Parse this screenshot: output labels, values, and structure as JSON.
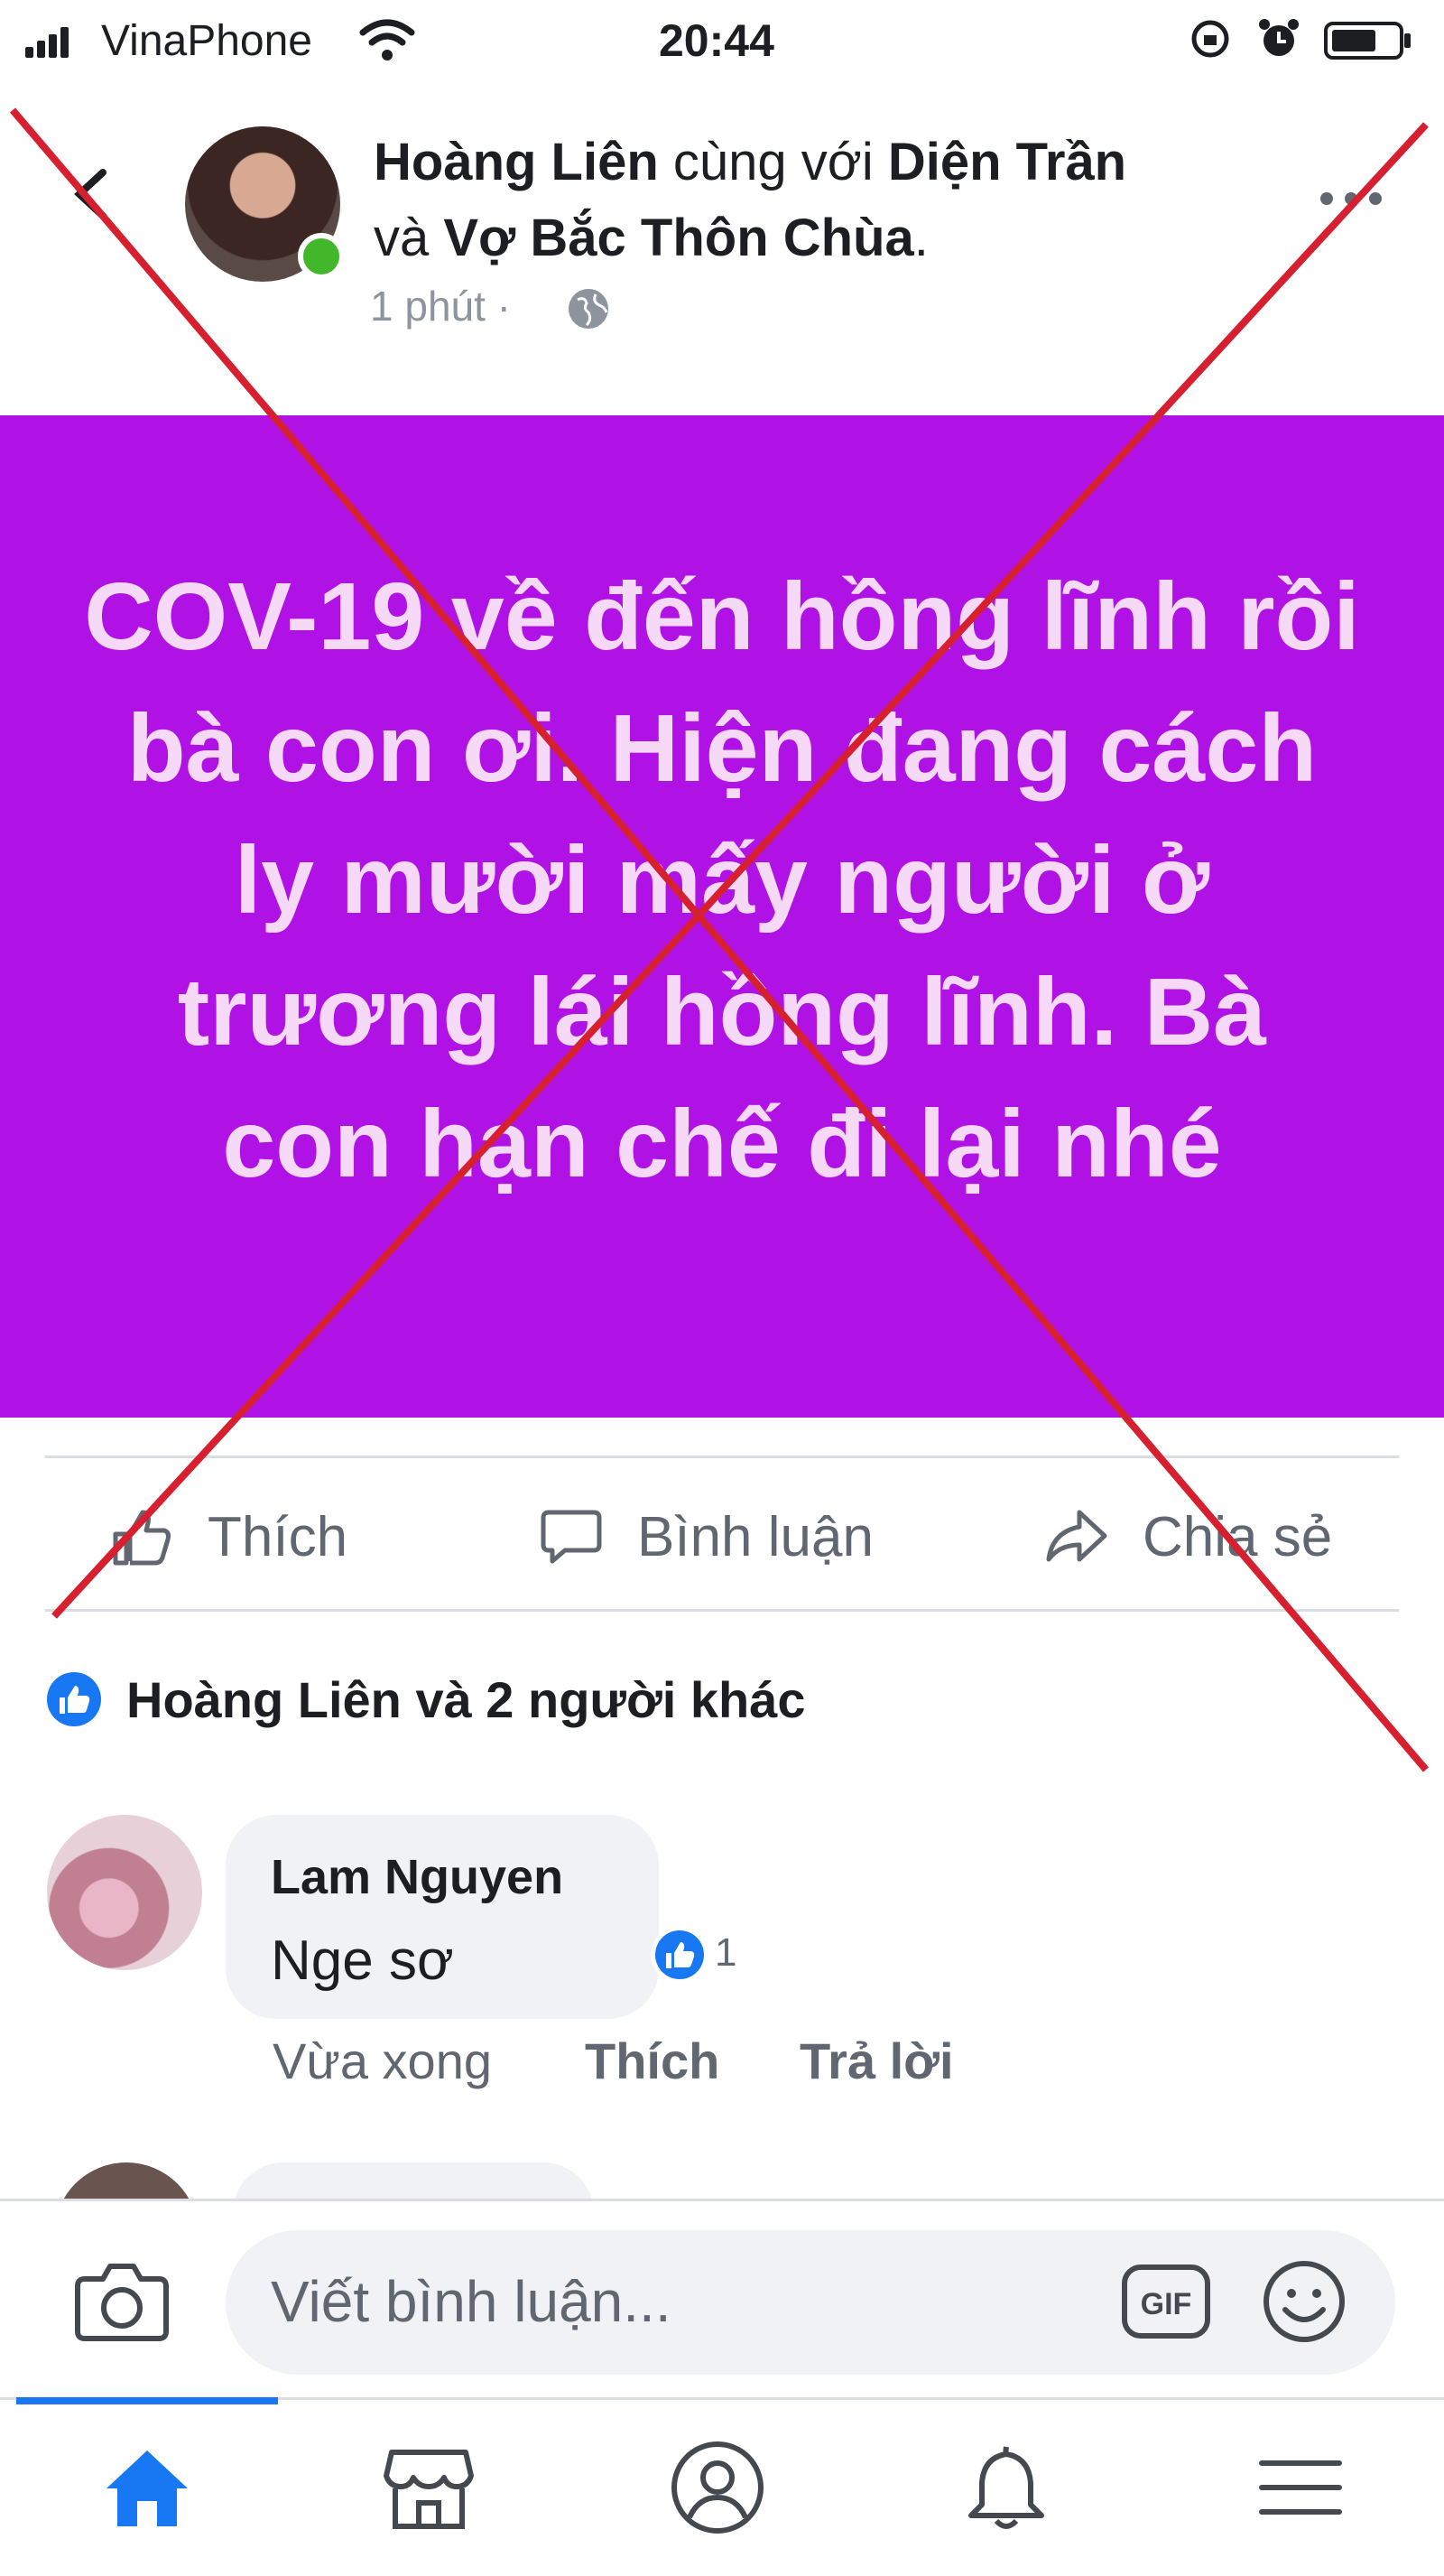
{
  "status_bar": {
    "carrier": "VinaPhone",
    "time": "20:44",
    "icons": [
      "signal-icon",
      "wifi-icon",
      "rotation-lock-icon",
      "alarm-icon",
      "battery-icon"
    ]
  },
  "post": {
    "author": "Hoàng Liên",
    "with_word": " cùng với ",
    "tagged_1": "Diện Trần",
    "and_word": "và ",
    "tagged_2": "Vợ Bắc Thôn Chùa",
    "period": ".",
    "time": "1 phút",
    "separator": " · ",
    "background_color": "#b012e6",
    "text": "COV-19 về đến hồng lĩnh rồi bà con ơi. Hiện đang cách ly mười mấy người ở trương lái hồng lĩnh. Bà con hạn chế đi lại nhé"
  },
  "actions": {
    "like": "Thích",
    "comment": "Bình luận",
    "share": "Chia sẻ"
  },
  "reactions": {
    "summary": "Hoàng Liên và 2 người khác"
  },
  "comment": {
    "name": "Lam Nguyen",
    "text": "Nge sơ",
    "like_count": "1",
    "time": "Vừa xong",
    "like": "Thích",
    "reply": "Trả lời"
  },
  "composer": {
    "placeholder": "Viết bình luận...",
    "gif": "GIF"
  },
  "bottom_nav": {
    "items": [
      "home-icon",
      "marketplace-icon",
      "profile-icon",
      "notifications-icon",
      "menu-icon"
    ],
    "active_color": "#1877f2"
  },
  "overlay": {
    "type": "red-x",
    "color": "#d62030"
  }
}
